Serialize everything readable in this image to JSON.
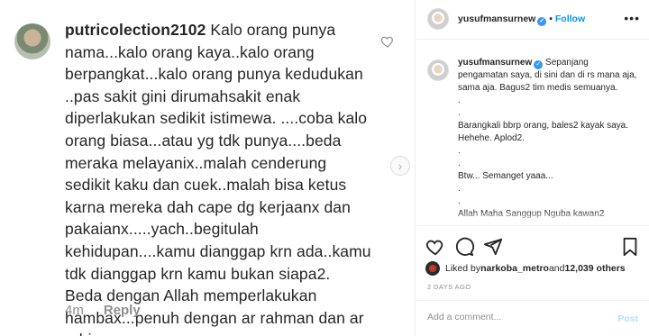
{
  "comment": {
    "username": "putricolection2102",
    "text": "Kalo orang punya nama...kalo orang kaya..kalo orang berpangkat...kalo orang punya kedudukan ..pas sakit gini dirumahsakit enak diperlakukan sedikit istimewa. ....coba kalo orang biasa...atau yg tdk punya....beda meraka melayanix..malah cenderung sedikit kaku dan cuek..malah bisa ketus karna mereka dah cape dg kerjaanx dan pakaianx.....yach..begitulah kehidupan....kamu dianggap krn ada..kamu tdk dianggap krn kamu bukan siapa2. Beda dengan Allah memperlakukan hambax...penuh dengan ar rahman dan ar rahim.",
    "time": "4m",
    "reply_label": "Reply"
  },
  "header": {
    "username": "yusufmansurnew",
    "separator": "•",
    "follow_label": "Follow",
    "more_label": "•••"
  },
  "caption": {
    "username": "yusufmansurnew",
    "text": " Sepanjang pengamatan saya, di sini dan di rs mana aja, sama aja. Bagus2 tim medis semuanya.\n.\n.\nBarangkali bbrp orang, bales2 kayak saya. Hehehe. Aplod2.\n.\n.\nBtw... Semanget yaaa...\n.\n.\nAllah Maha Sanggup Nguba kawan2"
  },
  "likes": {
    "prefix": "Liked by ",
    "user": "narkoba_metro",
    "middle": " and ",
    "count": "12,039 others"
  },
  "timestamp": "2 DAYS AGO",
  "add_comment": {
    "placeholder": "Add a comment...",
    "post_label": "Post"
  },
  "colors": {
    "link_blue": "#0095f6",
    "verified_blue": "#3897f0",
    "muted_gray": "#8e8e8e",
    "post_disabled": "#b2dffc"
  },
  "icons": [
    "heart-icon",
    "verified-icon",
    "more-options-icon",
    "comment-icon",
    "share-icon",
    "bookmark-icon",
    "chevron-right-icon"
  ]
}
